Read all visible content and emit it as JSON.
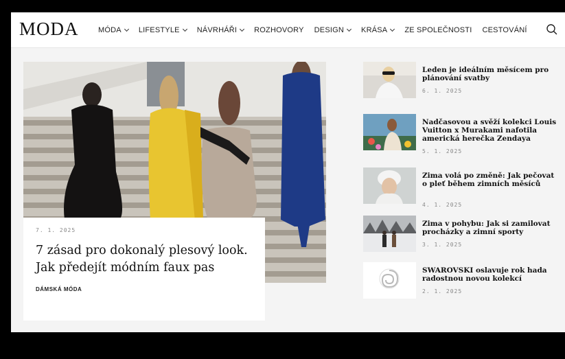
{
  "header": {
    "logo": "MODA",
    "nav": [
      {
        "label": "MÓDA",
        "dropdown": true
      },
      {
        "label": "LIFESTYLE",
        "dropdown": true
      },
      {
        "label": "NÁVRHÁŘI",
        "dropdown": true
      },
      {
        "label": "ROZHOVORY",
        "dropdown": false
      },
      {
        "label": "DESIGN",
        "dropdown": true
      },
      {
        "label": "KRÁSA",
        "dropdown": true
      },
      {
        "label": "ZE SPOLEČNOSTI",
        "dropdown": false
      },
      {
        "label": "CESTOVÁNÍ",
        "dropdown": false
      }
    ],
    "search_icon": "search-icon"
  },
  "hero": {
    "date": "7. 1. 2025",
    "title": "7 zásad pro dokonalý plesový look. Jak předejít módním faux pas",
    "category": "DÁMSKÁ MÓDA"
  },
  "articles": [
    {
      "title": "Leden je ideálním měsícem pro plánování svatby",
      "date": "6. 1. 2025"
    },
    {
      "title": "Nadčasovou a svěží kolekci Louis Vuitton x Murakami nafotila americká herečka Zendaya",
      "date": "5. 1. 2025"
    },
    {
      "title": "Zima volá po změně: Jak pečovat o pleť během zimních měsíců",
      "date": "4. 1. 2025"
    },
    {
      "title": "Zima v pohybu: Jak si zamilovat procházky a zimní sporty",
      "date": "3. 1. 2025"
    },
    {
      "title": "SWAROVSKI oslavuje rok hada radostnou novou kolekcí",
      "date": "2. 1. 2025"
    }
  ],
  "colors": {
    "page_bg": "#f4f4f4",
    "text": "#111111",
    "muted": "#888888"
  }
}
